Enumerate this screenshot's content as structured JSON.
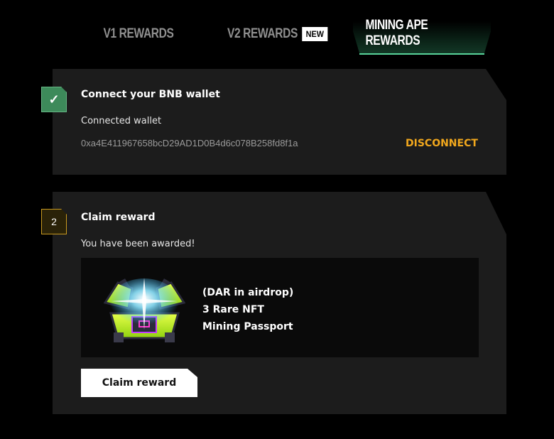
{
  "tabs": {
    "v1": "V1 REWARDS",
    "v2": "V2 REWARDS",
    "v2_badge": "NEW",
    "mining": "MINING APE REWARDS"
  },
  "step1": {
    "icon": "check-icon",
    "title": "Connect your BNB wallet",
    "connected_label": "Connected wallet",
    "wallet_address": "0xa4E411967658bcD29AD1D0B4d6c078B258fd8f1a",
    "disconnect_label": "DISCONNECT"
  },
  "step2": {
    "number": "2",
    "title": "Claim reward",
    "awarded_label": "You have been awarded!",
    "reward": {
      "image": "treasure-chest-icon",
      "line1": "(DAR in airdrop)",
      "line2": "3 Rare NFT",
      "line3": "Mining Passport"
    },
    "button_label": "Claim reward"
  },
  "colors": {
    "background": "#000000",
    "card": "#1c1c1c",
    "accent_green": "#58d39a",
    "step_done": "#3d8a5a",
    "step_pending_border": "#c99a20",
    "disconnect": "#f2a81d"
  }
}
